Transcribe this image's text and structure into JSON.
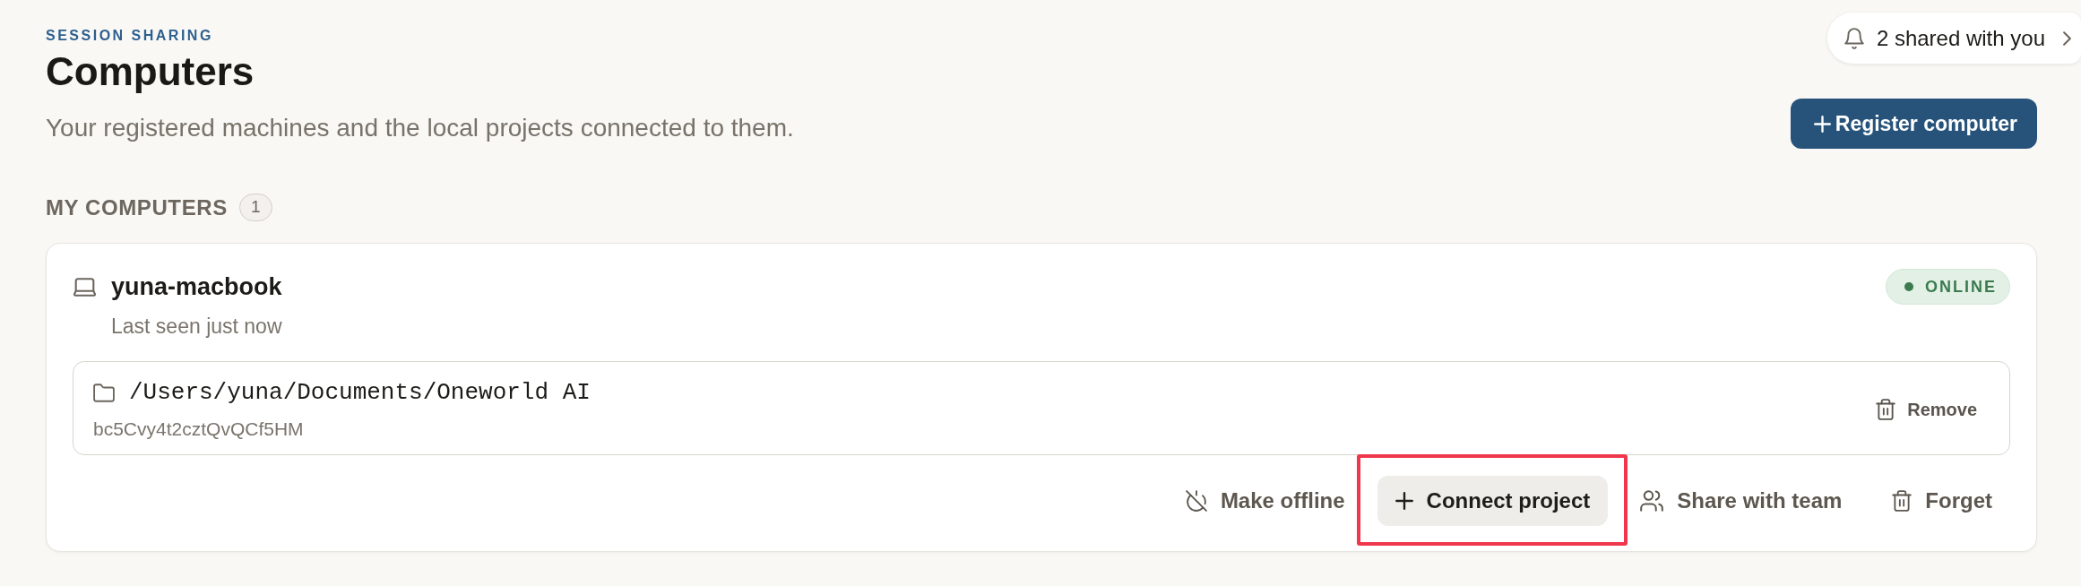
{
  "header": {
    "eyebrow": "SESSION SHARING",
    "title": "Computers",
    "subtitle": "Your registered machines and the local projects connected to them."
  },
  "notifications": {
    "label": "2 shared with you"
  },
  "register_button": {
    "label": "Register computer"
  },
  "section": {
    "title": "MY COMPUTERS",
    "count": "1"
  },
  "computers": [
    {
      "name": "yuna-macbook",
      "last_seen": "Last seen just now",
      "status": {
        "label": "ONLINE",
        "kind": "online"
      },
      "projects": [
        {
          "path": "/Users/yuna/Documents/Oneworld AI",
          "id": "bc5Cvy4t2cztQvQCf5HM",
          "action": "Remove"
        }
      ],
      "actions": [
        {
          "kind": "offline",
          "label": "Make offline",
          "filled": false,
          "highlighted": false
        },
        {
          "kind": "connect",
          "label": "Connect project",
          "filled": true,
          "highlighted": true
        },
        {
          "kind": "share",
          "label": "Share with team",
          "filled": false,
          "highlighted": false
        },
        {
          "kind": "forget",
          "label": "Forget",
          "filled": false,
          "highlighted": false
        }
      ]
    }
  ]
}
